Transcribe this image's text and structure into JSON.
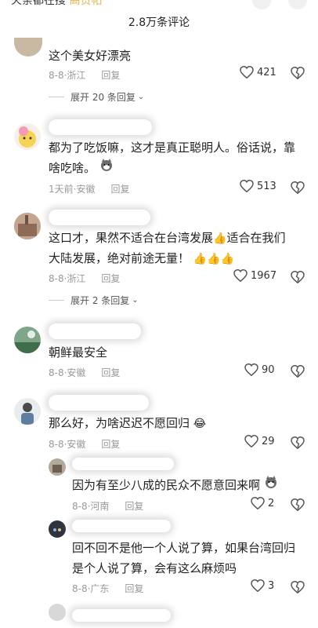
{
  "header": {
    "cut_text_left": "火荼都在搜",
    "cut_text_highlight": "高赞帖",
    "title": "2.8万条评论"
  },
  "comments": [
    {
      "text": "这个美女好漂亮",
      "meta": "8-8·浙江",
      "reply": "回复",
      "likes": "421"
    },
    {
      "expand": "展开 20 条回复"
    },
    {
      "text_line1": "都为了吃饭嘛，这才是真正聪明人。俗话说，靠",
      "text_line2": "啥吃啥。",
      "meta": "1天前·安徽",
      "reply": "回复",
      "likes": "513"
    },
    {
      "text_line1": "这口才，果然不适合在台湾发展",
      "text_line1b": "适合在我们",
      "text_line2": "大陆发展，绝对前途无量！",
      "meta": "8-8·浙江",
      "reply": "回复",
      "likes": "1967"
    },
    {
      "expand": "展开 2 条回复"
    },
    {
      "text": "朝鲜最安全",
      "meta": "8-8·安徽",
      "reply": "回复",
      "likes": "90"
    },
    {
      "text": "那么好，为啥迟迟不愿回归",
      "meta": "8-8·安徽",
      "reply": "回复",
      "likes": "29"
    },
    {
      "text": "因为有至少八成的民众不愿意回来啊",
      "meta": "8-8·河南",
      "reply": "回复",
      "likes": "2"
    },
    {
      "text_line1": "回不回不是他一个人说了算，如果台湾回归",
      "text_line2": "是个人说了算，会有这么麻烦吗",
      "meta": "8-8·广东",
      "reply": "回复",
      "likes": "3"
    }
  ]
}
